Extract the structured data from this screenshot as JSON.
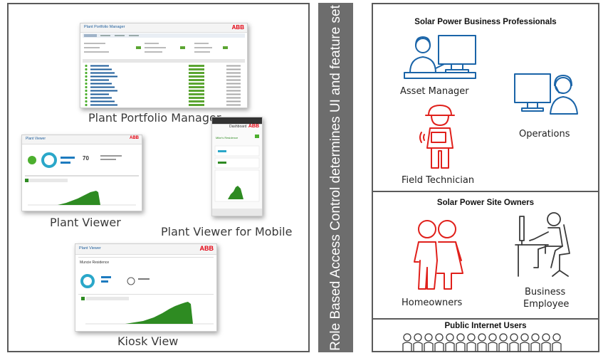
{
  "middle_label": "Role Based  Access Control determines UI and feature set",
  "left": {
    "captions": {
      "portfolio": "Plant Portfolio Manager",
      "viewer": "Plant Viewer",
      "mobile": "Plant Viewer for Mobile",
      "kiosk": "Kiosk View"
    },
    "mini": {
      "portfolio_title": "Plant Portfolio Manager",
      "viewer_title": "Plant Viewer",
      "mobile_title": "Dashboard",
      "kiosk_title": "Plant Viewer",
      "kiosk_sub": "Muncie Residence",
      "abb": "ABB",
      "viewer_value": "70",
      "mobile_site": "Mike's Residence"
    }
  },
  "right": {
    "sections": {
      "professionals": "Solar Power Business Professionals",
      "owners": "Solar Power Site Owners",
      "public": "Public Internet Users"
    },
    "roles": {
      "asset_manager": "Asset Manager",
      "operations": "Operations",
      "field_technician": "Field Technician",
      "homeowners": "Homeowners",
      "business_employee_1": "Business",
      "business_employee_2": "Employee"
    }
  },
  "colors": {
    "border": "#5a5a5a",
    "divider_bar": "#6d6d6d",
    "icon_blue": "#1a64a8",
    "icon_red": "#e0201b",
    "chart_green": "#2e8b22",
    "abb_red": "#e3000f"
  }
}
